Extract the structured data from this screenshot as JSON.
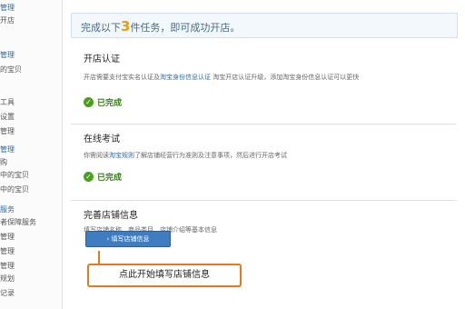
{
  "sidebar": {
    "items": [
      {
        "label": "管理",
        "kind": "head"
      },
      {
        "label": "开店",
        "kind": "plain"
      },
      {
        "label": "管理",
        "kind": "head"
      },
      {
        "label": "的宝贝",
        "kind": "plain"
      },
      {
        "label": "工具",
        "kind": "plain"
      },
      {
        "label": "设置",
        "kind": "plain"
      },
      {
        "label": "管理",
        "kind": "plain"
      },
      {
        "label": "管理",
        "kind": "head"
      },
      {
        "label": "购",
        "kind": "plain"
      },
      {
        "label": "中的宝贝",
        "kind": "plain"
      },
      {
        "label": "中的宝贝",
        "kind": "plain"
      },
      {
        "label": "服务",
        "kind": "head"
      },
      {
        "label": "者保障服务",
        "kind": "plain"
      },
      {
        "label": "管理",
        "kind": "plain"
      },
      {
        "label": "管理",
        "kind": "plain"
      },
      {
        "label": "管理",
        "kind": "plain"
      },
      {
        "label": "规划",
        "kind": "plain"
      },
      {
        "label": "记录",
        "kind": "plain"
      }
    ]
  },
  "banner": {
    "prefix": "完成以下",
    "count": "3",
    "suffix": "件任务，即可成功开店。"
  },
  "tasks": {
    "certification": {
      "title": "开店认证",
      "desc_prefix": "开店需要支付宝实名认证及",
      "desc_link": "淘宝身份信息认证",
      "desc_suffix": " 淘宝开店认证升级，添加淘宝身份信息认证可以更快",
      "status": "已完成"
    },
    "exam": {
      "title": "在线考试",
      "desc_prefix": "你需阅读",
      "desc_link": "淘宝规则",
      "desc_suffix": "了解店铺经营行为准则及注意事项，然后进行开店考试",
      "status": "已完成"
    },
    "shop_info": {
      "title": "完善店铺信息",
      "desc": "填写店铺名称、商品类目、店铺介绍等基本信息",
      "button_label": "› 填写店铺信息"
    }
  },
  "callout": {
    "text": "点此开始填写店铺信息"
  },
  "colors": {
    "accent_blue": "#3f7cc0",
    "success_green": "#4aa01e",
    "highlight_orange": "#f39800",
    "callout_border": "#e07b1f"
  }
}
